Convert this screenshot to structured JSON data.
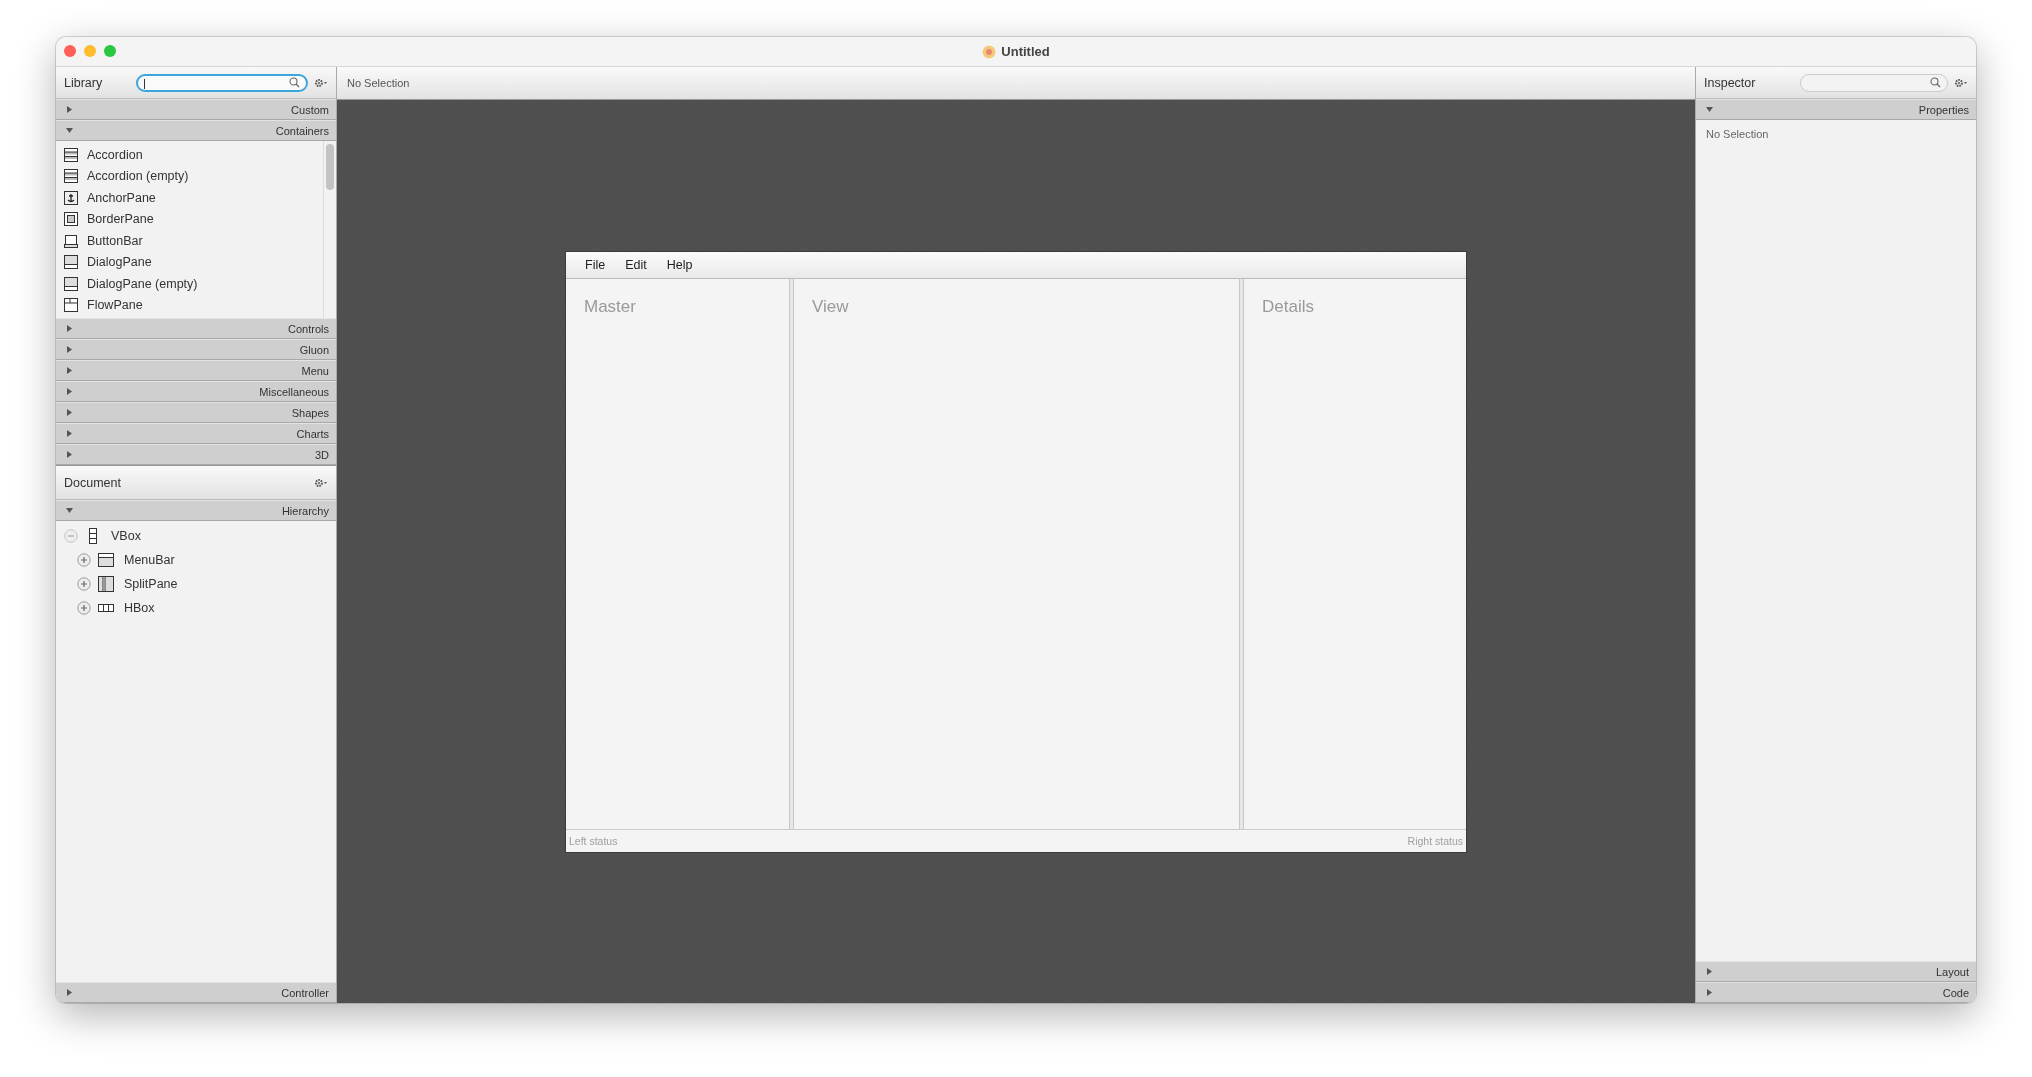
{
  "window": {
    "title": "Untitled"
  },
  "library": {
    "title": "Library",
    "search": {
      "focused": true
    },
    "sections": [
      {
        "label": "Custom",
        "expanded": false
      },
      {
        "label": "Containers",
        "expanded": true,
        "items": [
          {
            "label": "Accordion",
            "kind": "accordion"
          },
          {
            "label": "Accordion  (empty)",
            "kind": "accordion"
          },
          {
            "label": "AnchorPane",
            "kind": "anchor"
          },
          {
            "label": "BorderPane",
            "kind": "border"
          },
          {
            "label": "ButtonBar",
            "kind": "buttonbar"
          },
          {
            "label": "DialogPane",
            "kind": "dialog"
          },
          {
            "label": "DialogPane  (empty)",
            "kind": "dialog"
          },
          {
            "label": "FlowPane",
            "kind": "flow"
          }
        ]
      },
      {
        "label": "Controls",
        "expanded": false
      },
      {
        "label": "Gluon",
        "expanded": false
      },
      {
        "label": "Menu",
        "expanded": false
      },
      {
        "label": "Miscellaneous",
        "expanded": false
      },
      {
        "label": "Shapes",
        "expanded": false
      },
      {
        "label": "Charts",
        "expanded": false
      },
      {
        "label": "3D",
        "expanded": false
      }
    ]
  },
  "document": {
    "title": "Document",
    "sections": [
      {
        "label": "Hierarchy",
        "expanded": true,
        "tree": [
          {
            "label": "VBox",
            "kind": "vbox",
            "expanded": true,
            "children": [
              {
                "label": "MenuBar",
                "kind": "menubar",
                "expanded": false
              },
              {
                "label": "SplitPane",
                "kind": "splitpane",
                "expanded": false
              },
              {
                "label": "HBox",
                "kind": "hbox",
                "expanded": false
              }
            ]
          }
        ]
      },
      {
        "label": "Controller",
        "expanded": false
      }
    ]
  },
  "canvas": {
    "selection": "No Selection",
    "preview": {
      "menus": [
        "File",
        "Edit",
        "Help"
      ],
      "panes": [
        "Master",
        "View",
        "Details"
      ],
      "status_left": "Left status",
      "status_right": "Right status"
    }
  },
  "inspector": {
    "title": "Inspector",
    "search": {
      "focused": false
    },
    "sections": [
      {
        "label": "Properties",
        "expanded": true,
        "message": "No Selection"
      },
      {
        "label": "Layout",
        "expanded": false
      },
      {
        "label": "Code",
        "expanded": false
      }
    ]
  }
}
